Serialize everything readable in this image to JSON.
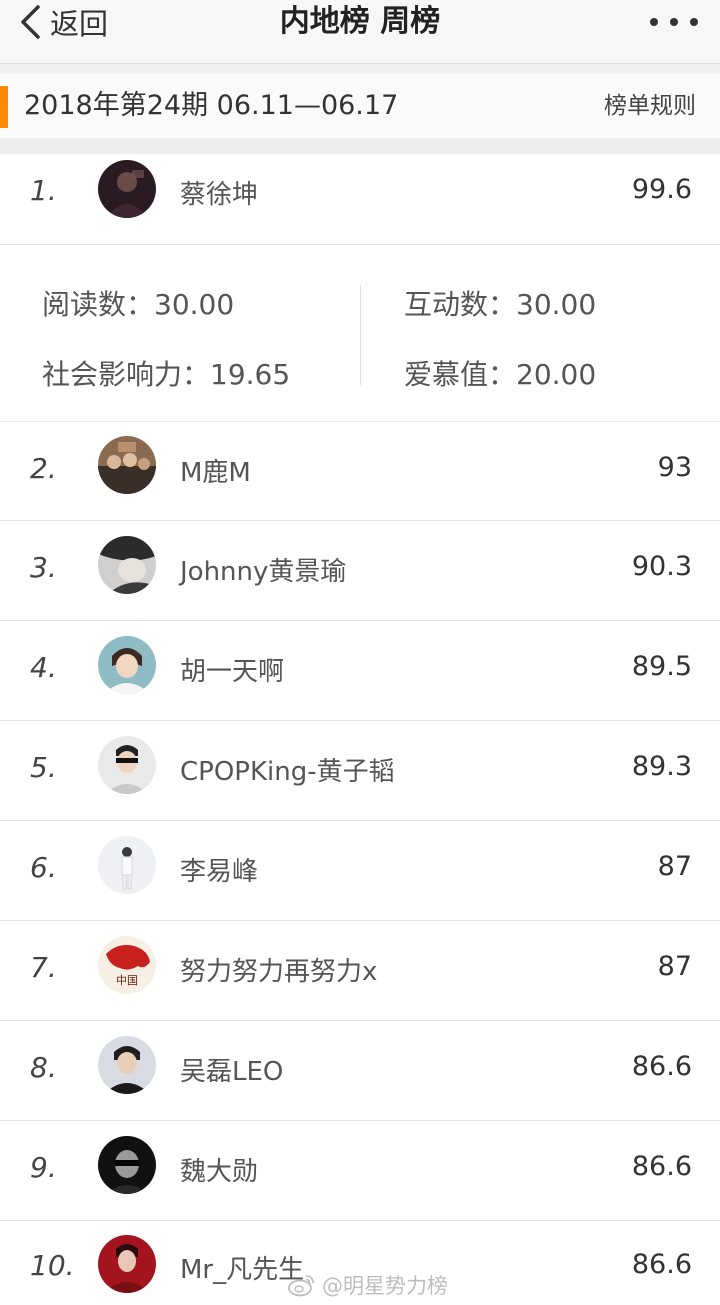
{
  "navbar": {
    "back_label": "返回",
    "title": "内地榜 周榜",
    "more_icon": "more-dots-icon"
  },
  "period": {
    "label": "2018年第24期  06.11—06.17",
    "rules_label": "榜单规则",
    "accent_color": "#ff8a00"
  },
  "top_stats": {
    "reads": "阅读数：30.00",
    "interactions": "互动数：30.00",
    "social_influence": "社会影响力：19.65",
    "love_value": "爱慕值：20.00"
  },
  "ranking": [
    {
      "rank": "1.",
      "name": "蔡徐坤",
      "score": "99.6"
    },
    {
      "rank": "2.",
      "name": "M鹿M",
      "score": "93"
    },
    {
      "rank": "3.",
      "name": "Johnny黄景瑜",
      "score": "90.3"
    },
    {
      "rank": "4.",
      "name": "胡一天啊",
      "score": "89.5"
    },
    {
      "rank": "5.",
      "name": "CPOPKing-黄子韬",
      "score": "89.3"
    },
    {
      "rank": "6.",
      "name": "李易峰",
      "score": "87"
    },
    {
      "rank": "7.",
      "name": "努力努力再努力x",
      "score": "87"
    },
    {
      "rank": "8.",
      "name": "吴磊LEO",
      "score": "86.6"
    },
    {
      "rank": "9.",
      "name": "魏大勋",
      "score": "86.6"
    },
    {
      "rank": "10.",
      "name": "Mr_凡先生",
      "score": "86.6"
    }
  ],
  "watermark": {
    "text": "@明星势力榜",
    "icon": "weibo-logo"
  }
}
